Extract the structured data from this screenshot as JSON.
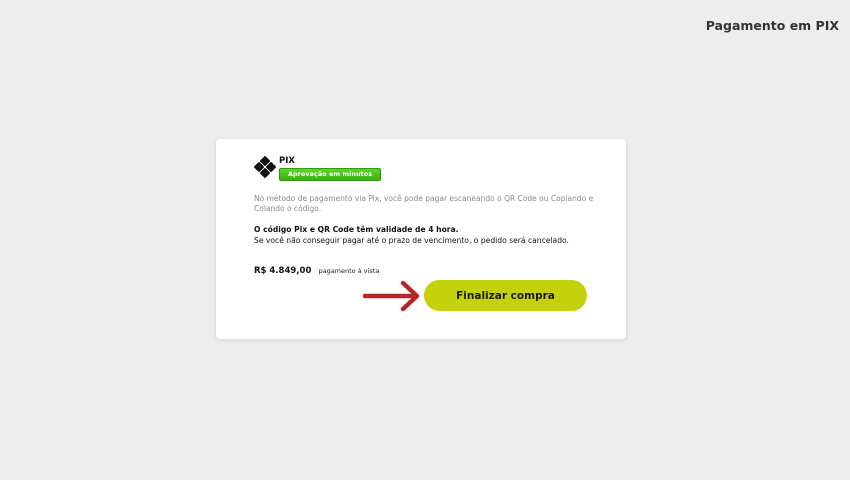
{
  "header": {
    "title": "Pagamento em PIX"
  },
  "payment": {
    "method_name": "PIX",
    "badge_label": "Aprovação em minutos",
    "description": "No método de pagamento via Pix, você pode pagar escaneando o QR Code ou Copiando e Colando o código.",
    "validity_bold": "O código Pix e QR Code têm validade de 4 hora.",
    "validity_note": "Se você não conseguir pagar até o prazo de vencimento, o pedido será cancelado.",
    "price": "R$ 4.849,00",
    "price_note": "pagamento à vista",
    "finish_button_label": "Finalizar compra"
  },
  "icons": {
    "logo": "pix-logo-icon",
    "pointer": "arrow-right-icon"
  },
  "colors": {
    "page_background": "#ededed",
    "card_background": "#ffffff",
    "badge_green": "#3cb514",
    "button_lime": "#c5d10a",
    "arrow_red": "#b3262a"
  }
}
